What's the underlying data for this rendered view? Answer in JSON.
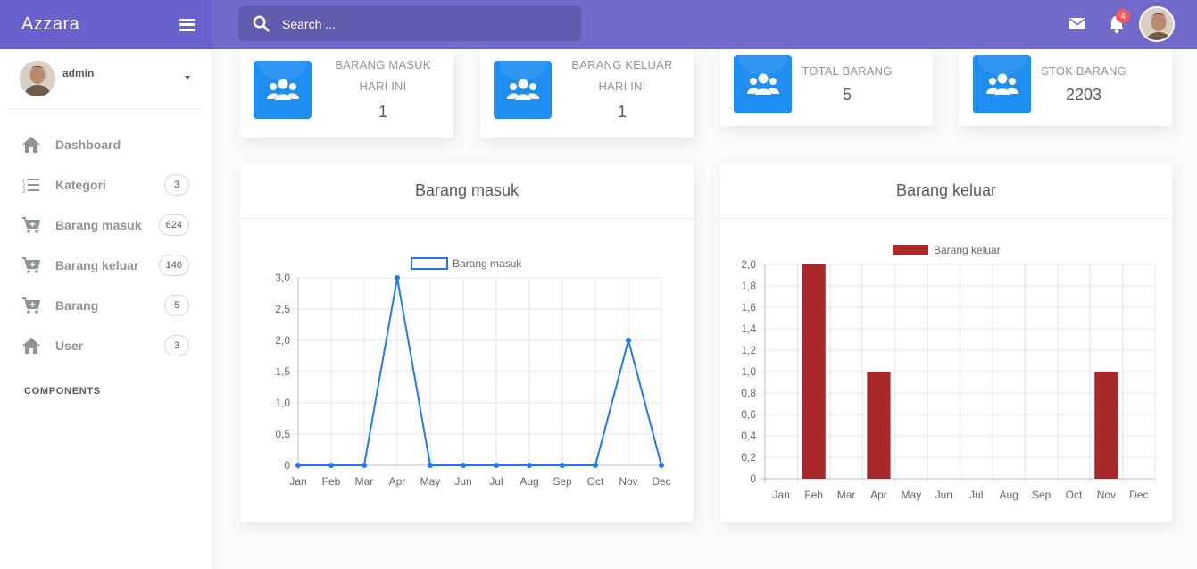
{
  "app": {
    "brand": "Azzara"
  },
  "search": {
    "placeholder": "Search ..."
  },
  "header": {
    "notification_count": "4",
    "icons": [
      "mail-icon",
      "bell-icon"
    ]
  },
  "user": {
    "name": "admin"
  },
  "sidebar": {
    "items": [
      {
        "label": "Dashboard",
        "icon": "home-icon",
        "count": null
      },
      {
        "label": "Kategori",
        "icon": "list-icon",
        "count": "3"
      },
      {
        "label": "Barang masuk",
        "icon": "cart-plus-icon",
        "count": "624"
      },
      {
        "label": "Barang keluar",
        "icon": "cart-plus-icon",
        "count": "140"
      },
      {
        "label": "Barang",
        "icon": "cart-plus-icon",
        "count": "5"
      },
      {
        "label": "User",
        "icon": "home-icon",
        "count": "3"
      }
    ],
    "section_title": "COMPONENTS"
  },
  "stats": [
    {
      "line1": "BARANG MASUK",
      "line2": "HARI INI",
      "value": "1",
      "icon": "users-icon"
    },
    {
      "line1": "BARANG KELUAR",
      "line2": "HARI INI",
      "value": "1",
      "icon": "users-icon"
    },
    {
      "line1": "TOTAL BARANG",
      "line2": "",
      "value": "5",
      "icon": "users-icon"
    },
    {
      "line1": "STOK BARANG",
      "line2": "",
      "value": "2203",
      "icon": "users-icon"
    }
  ],
  "colors": {
    "sidebar_header": "#6861ce",
    "navbar": "#716aca",
    "stat_icon": "#1f8ef1",
    "line": "#1d7af3",
    "bar": "#a9282a",
    "badge": "#f25961"
  },
  "chart_data": [
    {
      "type": "line",
      "title": "Barang masuk",
      "categories": [
        "Jan",
        "Feb",
        "Mar",
        "Apr",
        "May",
        "Jun",
        "Jul",
        "Aug",
        "Sep",
        "Oct",
        "Nov",
        "Dec"
      ],
      "series": [
        {
          "name": "Barang masuk",
          "values": [
            0,
            0,
            0,
            3,
            0,
            0,
            0,
            0,
            0,
            0,
            2,
            0
          ],
          "color": "#1d7af3"
        }
      ],
      "ylim": [
        0,
        3
      ],
      "yticks": [
        "0",
        "0,5",
        "1,0",
        "1,5",
        "2,0",
        "2,5",
        "3,0"
      ],
      "grid": true,
      "legend": "top"
    },
    {
      "type": "bar",
      "title": "Barang keluar",
      "categories": [
        "Jan",
        "Feb",
        "Mar",
        "Apr",
        "May",
        "Jun",
        "Jul",
        "Aug",
        "Sep",
        "Oct",
        "Nov",
        "Dec"
      ],
      "series": [
        {
          "name": "Barang keluar",
          "values": [
            0,
            2,
            0,
            1,
            0,
            0,
            0,
            0,
            0,
            0,
            1,
            0
          ],
          "color": "#a9282a"
        }
      ],
      "ylim": [
        0,
        2
      ],
      "yticks": [
        "0",
        "0,2",
        "0,4",
        "0,6",
        "0,8",
        "1,0",
        "1,2",
        "1,4",
        "1,6",
        "1,8",
        "2,0"
      ],
      "grid": true,
      "legend": "top"
    }
  ]
}
